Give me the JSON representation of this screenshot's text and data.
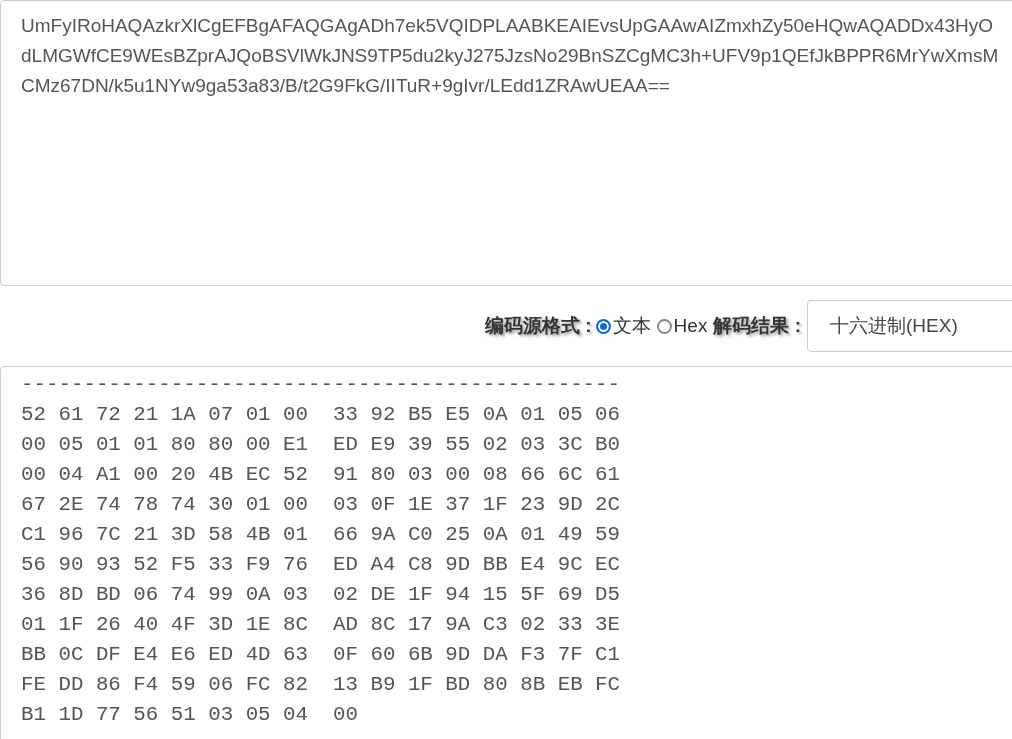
{
  "input": {
    "value": "UmFyIRoHAQAzkrXlCgEFBgAFAQGAgADh7ek5VQIDPLAABKEAIEvsUpGAAwAIZmxhZy50eHQwAQADDx43HyOdLMGWfCE9WEsBZprAJQoBSVlWkJNS9TP5du2kyJ275JzsNo29BnSZCgMC3h+UFV9p1QEfJkBPPR6MrYwXmsMCMz67DN/k5u1NYw9ga53a83/B/t2G9FkG/IITuR+9gIvr/LEdd1ZRAwUEAA=="
  },
  "options": {
    "source_label": "编码源格式 :",
    "formats": [
      {
        "label": "文本",
        "selected": true
      },
      {
        "label": "Hex",
        "selected": false
      }
    ],
    "result_label": "解码结果 :",
    "result_format": "十六进制(HEX)"
  },
  "output": {
    "lines": [
      "------------------------------------------------",
      "52 61 72 21 1A 07 01 00  33 92 B5 E5 0A 01 05 06",
      "00 05 01 01 80 80 00 E1  ED E9 39 55 02 03 3C B0",
      "00 04 A1 00 20 4B EC 52  91 80 03 00 08 66 6C 61",
      "67 2E 74 78 74 30 01 00  03 0F 1E 37 1F 23 9D 2C",
      "C1 96 7C 21 3D 58 4B 01  66 9A C0 25 0A 01 49 59",
      "56 90 93 52 F5 33 F9 76  ED A4 C8 9D BB E4 9C EC",
      "36 8D BD 06 74 99 0A 03  02 DE 1F 94 15 5F 69 D5",
      "01 1F 26 40 4F 3D 1E 8C  AD 8C 17 9A C3 02 33 3E",
      "BB 0C DF E4 E6 ED 4D 63  0F 60 6B 9D DA F3 7F C1",
      "FE DD 86 F4 59 06 FC 82  13 B9 1F BD 80 8B EB FC",
      "B1 1D 77 56 51 03 05 04  00"
    ]
  }
}
